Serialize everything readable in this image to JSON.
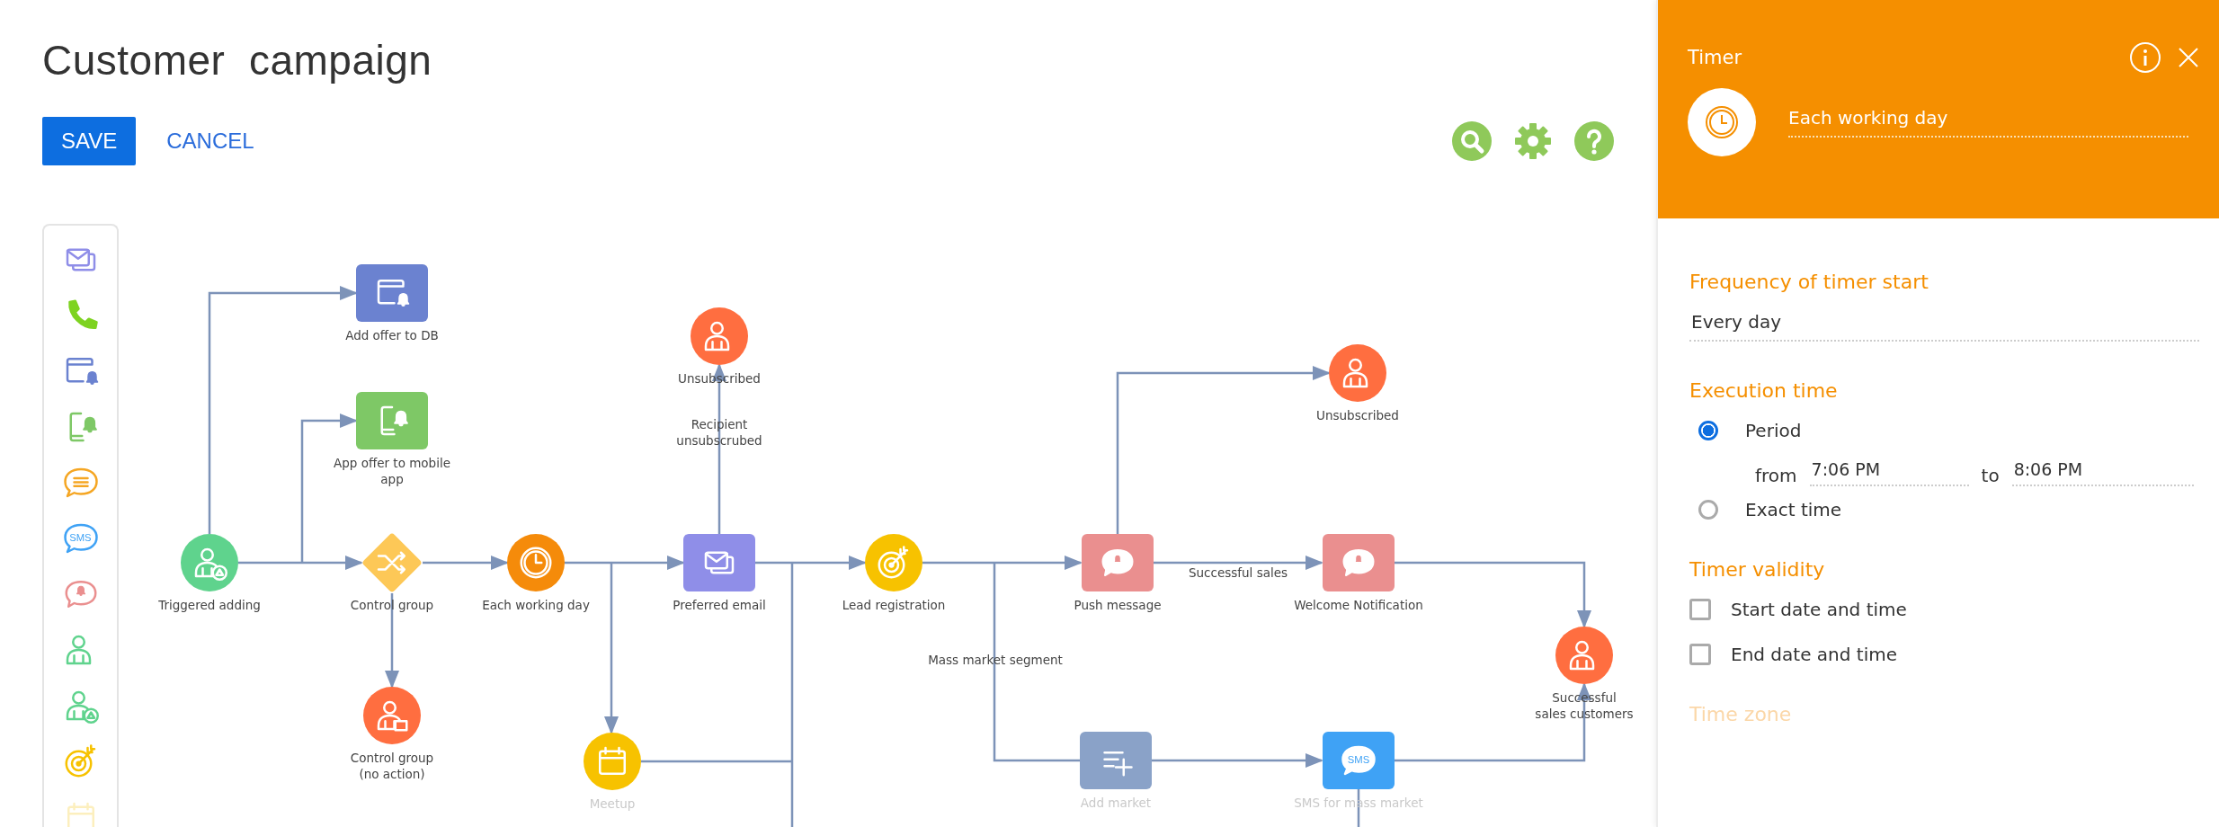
{
  "header": {
    "title": "Customer  campaign",
    "buttons": [
      {
        "label": "SAVE",
        "kind": "primary"
      },
      {
        "label": "CANCEL",
        "kind": "link"
      }
    ]
  },
  "palette": {
    "items": [
      {
        "kind": "email"
      },
      {
        "kind": "phone"
      },
      {
        "kind": "window-bell"
      },
      {
        "kind": "phone-bell"
      },
      {
        "kind": "chat"
      },
      {
        "kind": "sms",
        "text": "SMS"
      },
      {
        "kind": "bell-bubble"
      },
      {
        "kind": "person"
      },
      {
        "kind": "person-trigger"
      },
      {
        "kind": "target"
      },
      {
        "kind": "calendar"
      }
    ]
  },
  "diagram": {
    "nodes": [
      {
        "label": "Triggered adding",
        "kind": "trigger",
        "color": "#5fd38d",
        "faded": false
      },
      {
        "label": "Add offer to DB",
        "kind": "offer",
        "color": "#6b82d0",
        "faded": false
      },
      {
        "label": "App offer to mobile\napp",
        "kind": "mobile",
        "color": "#7ec866",
        "faded": false
      },
      {
        "label": "Control group",
        "kind": "split",
        "color": "#fdc857",
        "faded": false
      },
      {
        "label": "Control group\n(no action)",
        "kind": "holdout",
        "color": "#ff6e40",
        "faded": false
      },
      {
        "label": "Each working day",
        "kind": "timer",
        "color": "#f58b0a",
        "faded": false
      },
      {
        "label": "Meetup",
        "kind": "event",
        "color": "#f7c200",
        "faded": true
      },
      {
        "label": "Unsubscribed",
        "kind": "audience",
        "color": "#ff6e40",
        "faded": false
      },
      {
        "label": "Preferred email",
        "kind": "email",
        "color": "#8f8ee8",
        "faded": false
      },
      {
        "label": "Lead registration",
        "kind": "lead",
        "color": "#f7c200",
        "faded": false
      },
      {
        "label": "Unsubscribed",
        "kind": "audience",
        "color": "#ff6e40",
        "faded": false
      },
      {
        "label": "Push message",
        "kind": "push",
        "color": "#ea8f8f",
        "faded": false
      },
      {
        "label": "Welcome Notification",
        "kind": "push",
        "color": "#ea8f8f",
        "faded": false
      },
      {
        "label": "Add market",
        "kind": "segment",
        "color": "#8aa2c8",
        "faded": true
      },
      {
        "label": "SMS for mass market",
        "kind": "sms",
        "text": "SMS",
        "color": "#3fa2f5",
        "faded": true
      },
      {
        "label": "Successful\nsales customers",
        "kind": "audience",
        "color": "#ff6e40",
        "faded": false
      }
    ],
    "edge_labels": [
      "Recipient\nunsubscrubed",
      "Mass market segment",
      "Successful sales"
    ]
  },
  "panel": {
    "title": "Timer",
    "name_field": {
      "value": "Each working day"
    },
    "sections": [
      {
        "kind": "select",
        "heading": "Frequency of timer start",
        "value": "Every day",
        "faded": false
      },
      {
        "kind": "radios",
        "heading": "Execution time",
        "faded": false,
        "options": [
          {
            "label": "Period",
            "selected": true,
            "range": {
              "from_label": "from",
              "from": "7:06 PM",
              "to_label": "to",
              "to": "8:06 PM"
            }
          },
          {
            "label": "Exact time",
            "selected": false
          }
        ]
      },
      {
        "kind": "checks",
        "heading": "Timer validity",
        "faded": false,
        "options": [
          {
            "label": "Start date and time",
            "checked": false
          },
          {
            "label": "End date and time",
            "checked": false
          }
        ]
      },
      {
        "kind": "heading",
        "heading": "Time zone",
        "faded": true
      }
    ]
  }
}
